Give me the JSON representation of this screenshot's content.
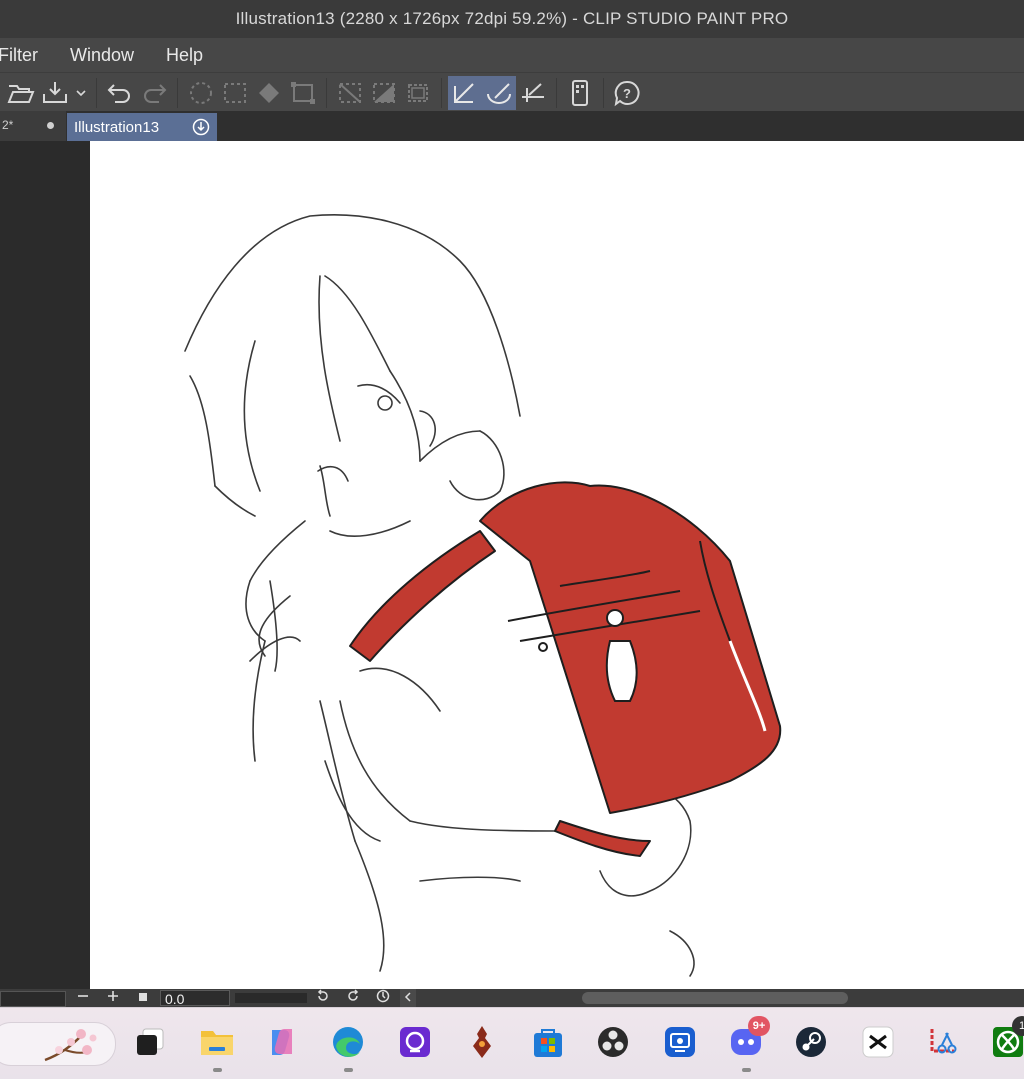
{
  "window": {
    "title": "Illustration13 (2280 x 1726px 72dpi 59.2%)  - CLIP STUDIO PAINT PRO"
  },
  "menu": {
    "items": [
      "Filter",
      "Window",
      "Help"
    ]
  },
  "toolbar": {
    "icons": [
      "open-icon",
      "save-icon",
      "save-dropdown-icon",
      "undo-icon",
      "redo-icon",
      "clear-selection-icon",
      "select-all-icon",
      "fill-icon",
      "transform-icon",
      "hide-selection-icon",
      "invert-selection-icon",
      "crop-icon",
      "snap-ruler-icon",
      "snap-special-ruler-icon",
      "snap-grid-icon",
      "smartphone-icon",
      "help-icon"
    ]
  },
  "tabs": {
    "previous": {
      "label": "2*"
    },
    "active": {
      "label": "Illustration13"
    }
  },
  "statusbar": {
    "rotation": "0.0"
  },
  "taskbar": {
    "apps": [
      "search-bar",
      "task-view",
      "file-explorer",
      "copilot",
      "edge",
      "ubisoft-connect",
      "app-game",
      "microsoft-store",
      "obs-studio",
      "remote-desktop",
      "discord",
      "steam",
      "capcut",
      "snipping-tool",
      "xbox"
    ],
    "discord_badge": "9+",
    "xbox_badge": "1"
  },
  "colors": {
    "accent": "#5b6f95",
    "backpack": "#c13a30"
  }
}
